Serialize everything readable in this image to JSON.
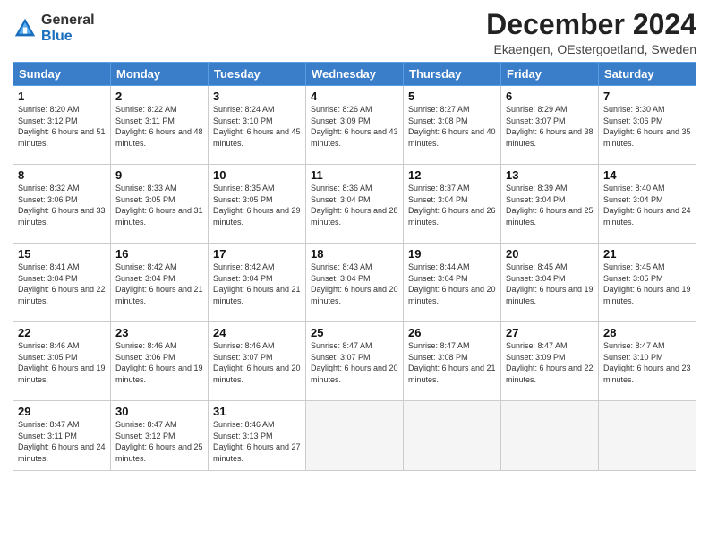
{
  "header": {
    "logo_general": "General",
    "logo_blue": "Blue",
    "month_title": "December 2024",
    "location": "Ekaengen, OEstergoetland, Sweden"
  },
  "days_of_week": [
    "Sunday",
    "Monday",
    "Tuesday",
    "Wednesday",
    "Thursday",
    "Friday",
    "Saturday"
  ],
  "weeks": [
    [
      {
        "day": "1",
        "sunrise": "8:20 AM",
        "sunset": "3:12 PM",
        "daylight": "6 hours and 51 minutes."
      },
      {
        "day": "2",
        "sunrise": "8:22 AM",
        "sunset": "3:11 PM",
        "daylight": "6 hours and 48 minutes."
      },
      {
        "day": "3",
        "sunrise": "8:24 AM",
        "sunset": "3:10 PM",
        "daylight": "6 hours and 45 minutes."
      },
      {
        "day": "4",
        "sunrise": "8:26 AM",
        "sunset": "3:09 PM",
        "daylight": "6 hours and 43 minutes."
      },
      {
        "day": "5",
        "sunrise": "8:27 AM",
        "sunset": "3:08 PM",
        "daylight": "6 hours and 40 minutes."
      },
      {
        "day": "6",
        "sunrise": "8:29 AM",
        "sunset": "3:07 PM",
        "daylight": "6 hours and 38 minutes."
      },
      {
        "day": "7",
        "sunrise": "8:30 AM",
        "sunset": "3:06 PM",
        "daylight": "6 hours and 35 minutes."
      }
    ],
    [
      {
        "day": "8",
        "sunrise": "8:32 AM",
        "sunset": "3:06 PM",
        "daylight": "6 hours and 33 minutes."
      },
      {
        "day": "9",
        "sunrise": "8:33 AM",
        "sunset": "3:05 PM",
        "daylight": "6 hours and 31 minutes."
      },
      {
        "day": "10",
        "sunrise": "8:35 AM",
        "sunset": "3:05 PM",
        "daylight": "6 hours and 29 minutes."
      },
      {
        "day": "11",
        "sunrise": "8:36 AM",
        "sunset": "3:04 PM",
        "daylight": "6 hours and 28 minutes."
      },
      {
        "day": "12",
        "sunrise": "8:37 AM",
        "sunset": "3:04 PM",
        "daylight": "6 hours and 26 minutes."
      },
      {
        "day": "13",
        "sunrise": "8:39 AM",
        "sunset": "3:04 PM",
        "daylight": "6 hours and 25 minutes."
      },
      {
        "day": "14",
        "sunrise": "8:40 AM",
        "sunset": "3:04 PM",
        "daylight": "6 hours and 24 minutes."
      }
    ],
    [
      {
        "day": "15",
        "sunrise": "8:41 AM",
        "sunset": "3:04 PM",
        "daylight": "6 hours and 22 minutes."
      },
      {
        "day": "16",
        "sunrise": "8:42 AM",
        "sunset": "3:04 PM",
        "daylight": "6 hours and 21 minutes."
      },
      {
        "day": "17",
        "sunrise": "8:42 AM",
        "sunset": "3:04 PM",
        "daylight": "6 hours and 21 minutes."
      },
      {
        "day": "18",
        "sunrise": "8:43 AM",
        "sunset": "3:04 PM",
        "daylight": "6 hours and 20 minutes."
      },
      {
        "day": "19",
        "sunrise": "8:44 AM",
        "sunset": "3:04 PM",
        "daylight": "6 hours and 20 minutes."
      },
      {
        "day": "20",
        "sunrise": "8:45 AM",
        "sunset": "3:04 PM",
        "daylight": "6 hours and 19 minutes."
      },
      {
        "day": "21",
        "sunrise": "8:45 AM",
        "sunset": "3:05 PM",
        "daylight": "6 hours and 19 minutes."
      }
    ],
    [
      {
        "day": "22",
        "sunrise": "8:46 AM",
        "sunset": "3:05 PM",
        "daylight": "6 hours and 19 minutes."
      },
      {
        "day": "23",
        "sunrise": "8:46 AM",
        "sunset": "3:06 PM",
        "daylight": "6 hours and 19 minutes."
      },
      {
        "day": "24",
        "sunrise": "8:46 AM",
        "sunset": "3:07 PM",
        "daylight": "6 hours and 20 minutes."
      },
      {
        "day": "25",
        "sunrise": "8:47 AM",
        "sunset": "3:07 PM",
        "daylight": "6 hours and 20 minutes."
      },
      {
        "day": "26",
        "sunrise": "8:47 AM",
        "sunset": "3:08 PM",
        "daylight": "6 hours and 21 minutes."
      },
      {
        "day": "27",
        "sunrise": "8:47 AM",
        "sunset": "3:09 PM",
        "daylight": "6 hours and 22 minutes."
      },
      {
        "day": "28",
        "sunrise": "8:47 AM",
        "sunset": "3:10 PM",
        "daylight": "6 hours and 23 minutes."
      }
    ],
    [
      {
        "day": "29",
        "sunrise": "8:47 AM",
        "sunset": "3:11 PM",
        "daylight": "6 hours and 24 minutes."
      },
      {
        "day": "30",
        "sunrise": "8:47 AM",
        "sunset": "3:12 PM",
        "daylight": "6 hours and 25 minutes."
      },
      {
        "day": "31",
        "sunrise": "8:46 AM",
        "sunset": "3:13 PM",
        "daylight": "6 hours and 27 minutes."
      },
      null,
      null,
      null,
      null
    ]
  ]
}
